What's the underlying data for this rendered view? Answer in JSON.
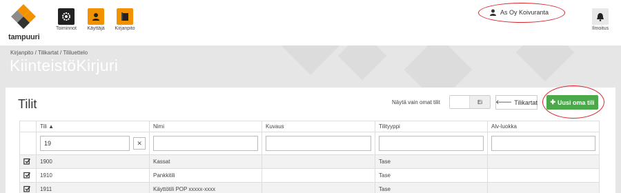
{
  "brand": {
    "name": "tampuuri",
    "colors": {
      "orange": "#f39200",
      "dark": "#333333",
      "gray": "#8c8c8c"
    }
  },
  "nav": [
    {
      "label": "Toiminnot",
      "icon": "gear-icon",
      "color": "#222222"
    },
    {
      "label": "Käyttäjä",
      "icon": "user-icon",
      "color": "#f39200"
    },
    {
      "label": "Kirjanpito",
      "icon": "book-icon",
      "color": "#f39200"
    }
  ],
  "user": {
    "company": "As Oy Koivuranta",
    "icon": "user-icon"
  },
  "notifications": {
    "label": "Ilmoitus",
    "icon": "bell-icon"
  },
  "breadcrumb": "Kirjanpito / Tilikartat / Tililuettelo",
  "page_title": "KiinteistöKirjuri",
  "card": {
    "title": "Tilit",
    "toggle_label": "Näytä vain omat tilit",
    "toggle_value": "Ei",
    "back_button": "Tilikartat",
    "new_button": "Uusi oma tili",
    "accent": "#4ba94a"
  },
  "table": {
    "columns": [
      "Tili ▲",
      "Nimi",
      "Kuvaus",
      "Tilityyppi",
      "Alv-luokka"
    ],
    "filter_value": "19",
    "clear_label": "✕",
    "rows": [
      {
        "tili": "1900",
        "nimi": "Kassat",
        "kuvaus": "",
        "tyyppi": "Tase",
        "alv": ""
      },
      {
        "tili": "1910",
        "nimi": "Pankkitili",
        "kuvaus": "",
        "tyyppi": "Tase",
        "alv": ""
      },
      {
        "tili": "1911",
        "nimi": "Käyttötili POP xxxxx-xxxx",
        "kuvaus": "",
        "tyyppi": "Tase",
        "alv": ""
      }
    ]
  }
}
